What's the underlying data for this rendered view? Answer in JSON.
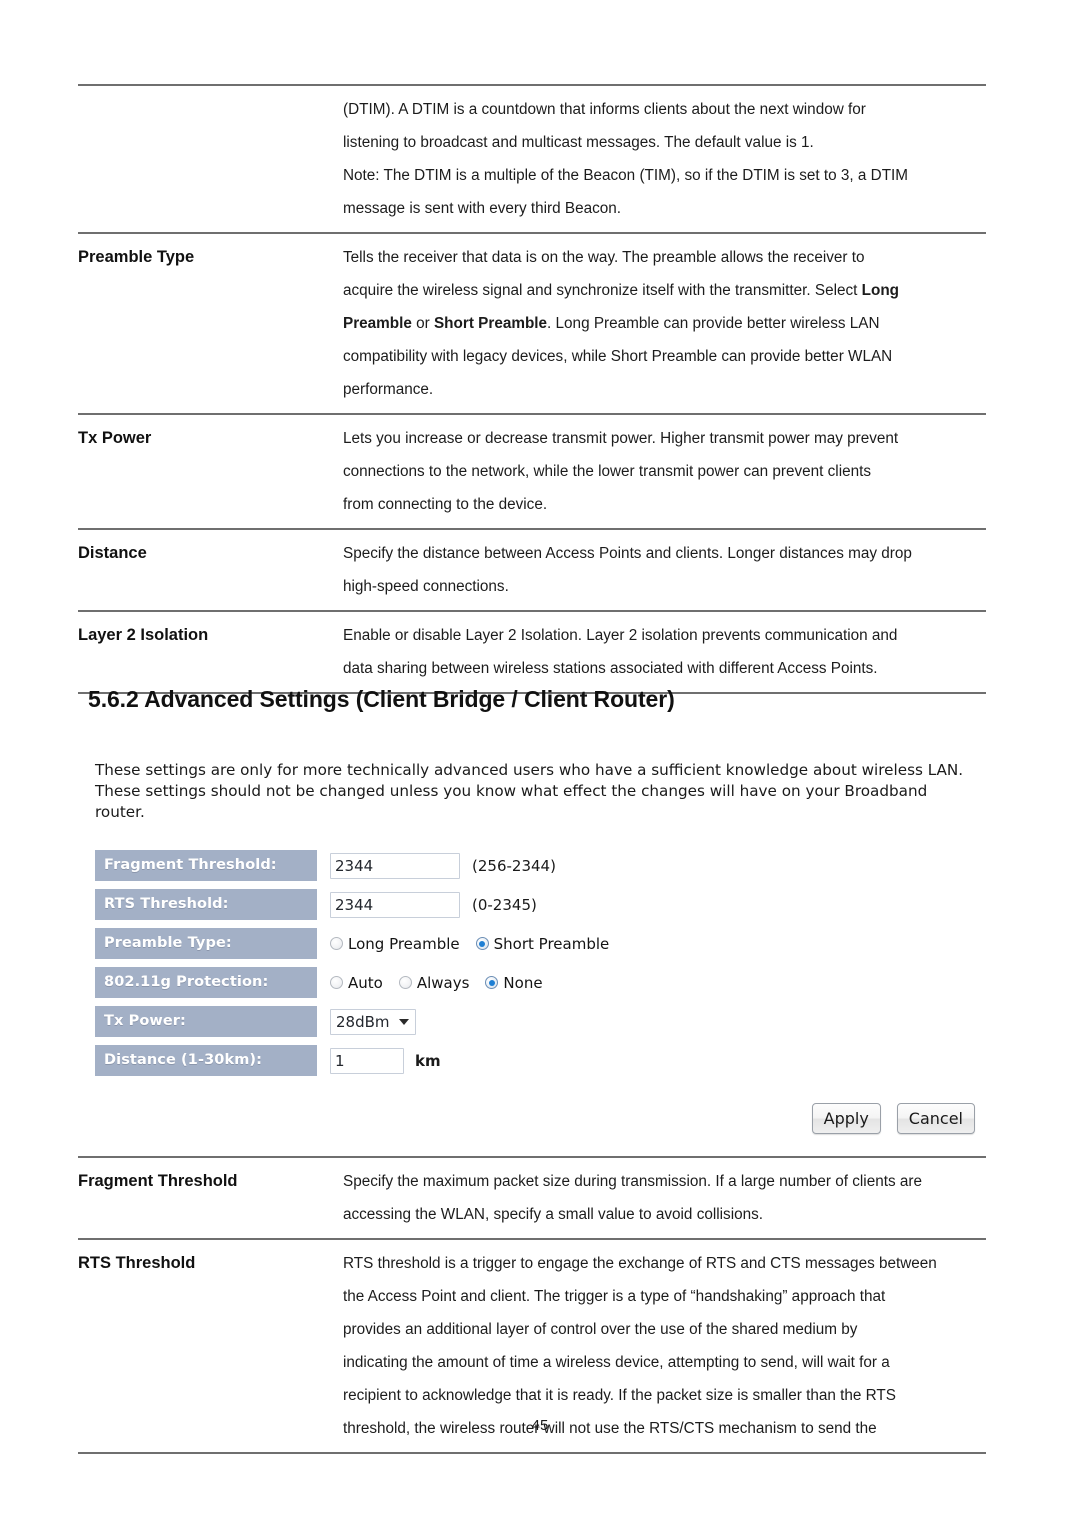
{
  "document": {
    "page_number": "45",
    "section_heading": "5.6.2 Advanced Settings (Client Bridge / Client Router)"
  },
  "table_top": {
    "rows": [
      {
        "term": "",
        "lines": [
          "(DTIM). A DTIM is a countdown that informs clients about the next window for",
          "listening to broadcast and multicast messages. The default value is 1.",
          "Note: The DTIM is a multiple of the Beacon (TIM), so if the DTIM is set to 3, a DTIM",
          "message is sent with every third Beacon."
        ]
      },
      {
        "term": "Preamble Type",
        "lines": [
          "Tells the receiver that data is on the way. The preamble allows the receiver to",
          "acquire the wireless signal and synchronize itself with the transmitter. Select <b>Long</b>",
          "<b>Preamble</b> or <b>Short Preamble</b>. Long Preamble can provide better wireless LAN",
          "compatibility with legacy devices, while Short Preamble can provide better WLAN",
          "performance."
        ]
      },
      {
        "term": "Tx Power",
        "lines": [
          "Lets you increase or decrease transmit power. Higher transmit power may prevent",
          "connections to the network, while the lower transmit power can prevent clients",
          "from connecting to the device."
        ]
      },
      {
        "term": "Distance",
        "lines": [
          "Specify the distance between Access Points and clients. Longer distances may drop",
          "high-speed connections."
        ]
      },
      {
        "term": "Layer 2 Isolation",
        "lines": [
          "Enable or disable Layer 2 Isolation. Layer 2 isolation prevents communication and",
          "data sharing between wireless stations associated with different Access Points."
        ]
      }
    ]
  },
  "router_ui": {
    "intro": "These settings are only for more technically advanced users who have a sufficient knowledge about wireless LAN. These settings should not be changed unless you know what effect the changes will have on your Broadband router.",
    "fields": {
      "fragment_threshold": {
        "label": "Fragment Threshold:",
        "value": "2344",
        "hint": "(256-2344)"
      },
      "rts_threshold": {
        "label": "RTS Threshold:",
        "value": "2344",
        "hint": "(0-2345)"
      },
      "preamble_type": {
        "label": "Preamble Type:",
        "options": [
          {
            "label": "Long Preamble",
            "selected": false
          },
          {
            "label": "Short Preamble",
            "selected": true
          }
        ]
      },
      "protection_11g": {
        "label": "802.11g Protection:",
        "options": [
          {
            "label": "Auto",
            "selected": false
          },
          {
            "label": "Always",
            "selected": false
          },
          {
            "label": "None",
            "selected": true
          }
        ]
      },
      "tx_power": {
        "label": "Tx Power:",
        "value": "28dBm"
      },
      "distance": {
        "label": "Distance (1-30km):",
        "value": "1",
        "unit": "km"
      }
    },
    "buttons": {
      "apply": "Apply",
      "cancel": "Cancel"
    },
    "colors": {
      "label_bar": "#a3b0c6",
      "label_text": "#ffffff",
      "radio_selected": "#1e7fd4"
    }
  },
  "table_bottom": {
    "rows": [
      {
        "term": "Fragment Threshold",
        "lines": [
          "Specify the maximum packet size during transmission. If a large number of clients are",
          "accessing the WLAN, specify a small value to avoid collisions."
        ]
      },
      {
        "term": "RTS Threshold",
        "lines": [
          "RTS threshold is a trigger to engage the exchange of RTS and CTS messages between",
          "the Access Point and client. The trigger is a type of “handshaking” approach that",
          "provides an additional layer of control over the use of the shared medium by",
          "indicating the amount of time a wireless device, attempting to send, will wait for a",
          "recipient to acknowledge that it is ready. If the packet size is smaller than the RTS",
          "threshold, the wireless router will not use the RTS/CTS mechanism to send the"
        ]
      }
    ]
  }
}
